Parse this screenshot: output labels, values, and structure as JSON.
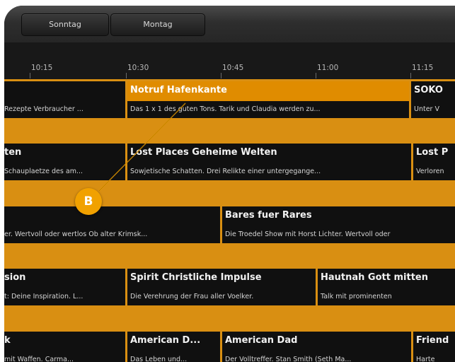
{
  "days": [
    "Sonntag",
    "Montag"
  ],
  "times": [
    "10:15",
    "10:30",
    "10:45",
    "11:00",
    "11:15"
  ],
  "rows": [
    {
      "programs": [
        {
          "title": "",
          "desc": "Rezepte Verbraucher ...",
          "selected": false
        },
        {
          "title": "Notruf Hafenkante",
          "desc": "Das 1 x 1 des guten Tons. Tarik und Claudia werden zu...",
          "selected": true
        },
        {
          "title": "SOKO",
          "desc": "Unter V",
          "selected": false
        }
      ]
    },
    {
      "programs": [
        {
          "title": "ten",
          "desc": "Schauplaetze des am...",
          "selected": false
        },
        {
          "title": "Lost Places Geheime Welten",
          "desc": "Sowjetische Schatten. Drei Relikte einer untergegange...",
          "selected": false
        },
        {
          "title": "Lost P",
          "desc": "Verloren",
          "selected": false
        }
      ]
    },
    {
      "programs": [
        {
          "title": "",
          "desc": "er. Wertvoll oder wertlos Ob alter Krimsk...",
          "selected": false
        },
        {
          "title": "Bares fuer Rares",
          "desc": "Die Troedel Show mit Horst Lichter. Wertvoll oder",
          "selected": false
        }
      ]
    },
    {
      "programs": [
        {
          "title": "sion",
          "desc": "t: Deine Inspiration. L...",
          "selected": false
        },
        {
          "title": "Spirit Christliche Impulse",
          "desc": "Die Verehrung der Frau aller Voelker.",
          "selected": false
        },
        {
          "title": "Hautnah Gott mitten",
          "desc": "Talk mit prominenten",
          "selected": false
        }
      ]
    },
    {
      "programs": [
        {
          "title": "k",
          "desc": "mit Waffen. Carma...",
          "selected": false
        },
        {
          "title": "American D...",
          "desc": "Das Leben und...",
          "selected": false
        },
        {
          "title": "American Dad",
          "desc": "Der Volltreffer. Stan Smith (Seth Ma...",
          "selected": false
        },
        {
          "title": "Friend",
          "desc": "Harte",
          "selected": false
        }
      ]
    }
  ],
  "callout": {
    "label": "B"
  }
}
